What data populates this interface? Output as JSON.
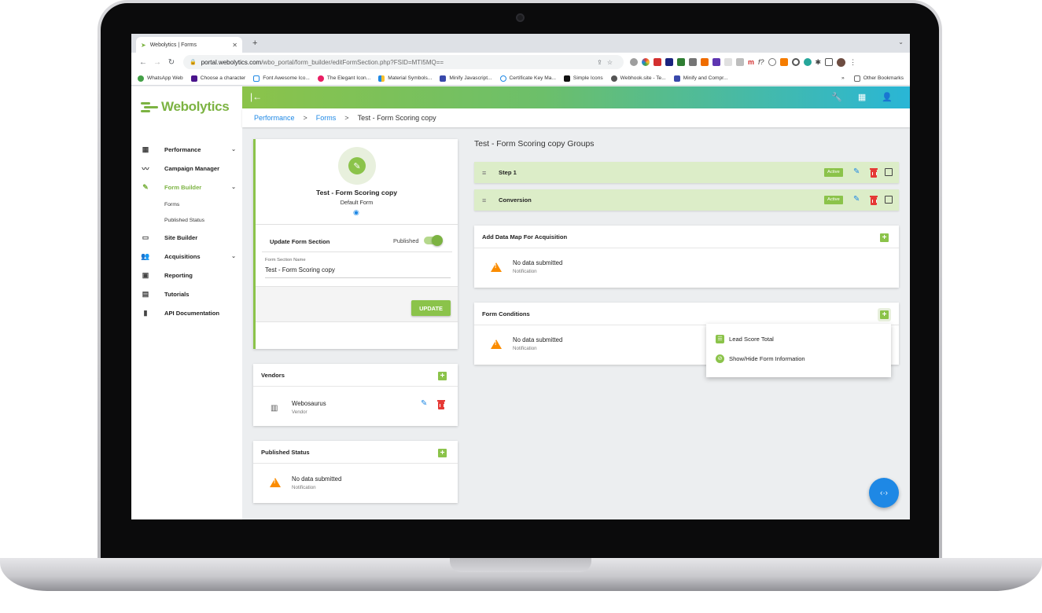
{
  "browser": {
    "tab_title": "Webolytics | Forms",
    "url_host": "portal.webolytics.com",
    "url_path": "/wbo_portal/form_builder/editFormSection.php?FSID=MTI5MQ==",
    "bookmarks": [
      "WhatsApp Web",
      "Choose a character",
      "Font Awesome Ico...",
      "The Elegant Icon...",
      "Material Symbols...",
      "Minify Javascript...",
      "Certificate Key Ma...",
      "Simple Icons",
      "Webhook.site - Te...",
      "Minify and Compr..."
    ],
    "overflow": "»",
    "other_bookmarks": "Other Bookmarks"
  },
  "logo": {
    "name": "Webolytics",
    "color": "#7cb342"
  },
  "sidebar": {
    "items": [
      {
        "label": "Performance",
        "icon": "dashboard-icon"
      },
      {
        "label": "Campaign Manager",
        "icon": "trend-icon"
      },
      {
        "label": "Form Builder",
        "icon": "form-edit-icon"
      },
      {
        "label": "Site Builder",
        "icon": "browser-icon"
      },
      {
        "label": "Acquisitions",
        "icon": "people-icon"
      },
      {
        "label": "Reporting",
        "icon": "archive-icon"
      },
      {
        "label": "Tutorials",
        "icon": "video-library-icon"
      },
      {
        "label": "API Documentation",
        "icon": "book-icon"
      }
    ],
    "sub_items": [
      "Forms",
      "Published Status"
    ]
  },
  "breadcrumb": {
    "items": [
      "Performance",
      "Forms",
      "Test - Form Scoring copy"
    ],
    "separator": ">"
  },
  "form_card": {
    "title": "Test - Form Scoring copy",
    "subtitle": "Default Form",
    "section_heading": "Update Form Section",
    "published_label": "Published",
    "published_on": true,
    "field_label": "Form Section Name",
    "field_value": "Test - Form Scoring copy",
    "update_button": "UPDATE"
  },
  "vendors": {
    "title": "Vendors",
    "items": [
      {
        "name": "Webosaurus",
        "type": "Vendor"
      }
    ]
  },
  "published_status": {
    "title": "Published Status",
    "empty_title": "No data submitted",
    "empty_sub": "Notification"
  },
  "groups": {
    "title": "Test - Form Scoring copy Groups",
    "rows": [
      {
        "name": "Step 1",
        "status": "Active"
      },
      {
        "name": "Conversion",
        "status": "Active"
      }
    ]
  },
  "data_map": {
    "title": "Add Data Map For Acquisition",
    "empty_title": "No data submitted",
    "empty_sub": "Notification"
  },
  "form_conditions": {
    "title": "Form Conditions",
    "empty_title": "No data submitted",
    "empty_sub": "Notification"
  },
  "dropdown": {
    "items": [
      "Lead Score Total",
      "Show/Hide Form Information"
    ]
  },
  "colors": {
    "accent_green": "#8bc34a",
    "link_blue": "#1e88e5",
    "delete_red": "#e53935",
    "warning_orange": "#fb8c00"
  }
}
